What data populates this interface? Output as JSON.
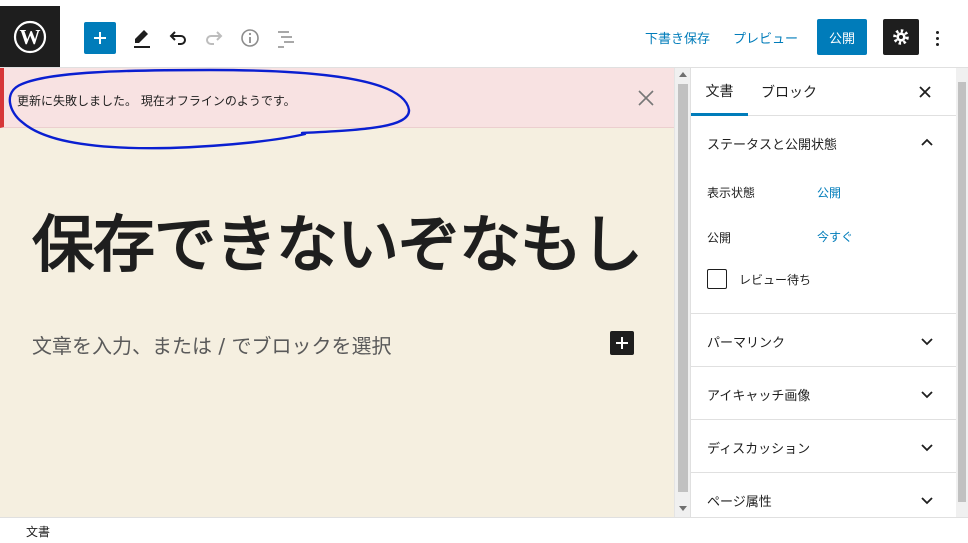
{
  "toolbar": {
    "save_draft": "下書き保存",
    "preview": "プレビュー",
    "publish": "公開"
  },
  "notice": {
    "text": "更新に失敗しました。 現在オフラインのようです。"
  },
  "editor": {
    "title": "保存できないぞなもし",
    "placeholder": "文章を入力、または / でブロックを選択"
  },
  "sidebar": {
    "tabs": [
      {
        "label": "文書",
        "active": true
      },
      {
        "label": "ブロック",
        "active": false
      }
    ],
    "status_panel": {
      "title": "ステータスと公開状態",
      "visibility_label": "表示状態",
      "visibility_value": "公開",
      "publish_label": "公開",
      "publish_value": "今すぐ",
      "pending_review_label": "レビュー待ち",
      "pending_review_checked": false
    },
    "panels": [
      {
        "title": "パーマリンク"
      },
      {
        "title": "アイキャッチ画像"
      },
      {
        "title": "ディスカッション"
      },
      {
        "title": "ページ属性"
      }
    ]
  },
  "footer": {
    "breadcrumb": "文書"
  },
  "colors": {
    "accent": "#007cba",
    "dark": "#1e1e1e",
    "error": "#d63638",
    "canvas": "#f5efe0",
    "annotation": "#0a1fd1"
  }
}
